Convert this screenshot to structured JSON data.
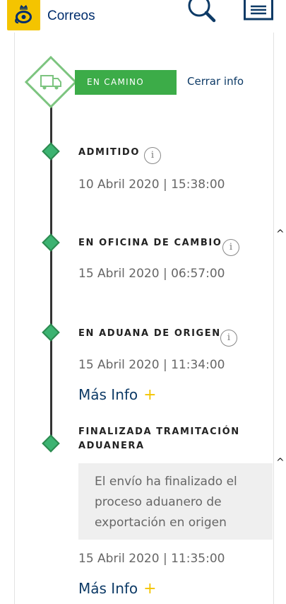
{
  "header": {
    "brand": "Correos",
    "icons": {
      "logo": "post-horn-crown-icon",
      "search": "search-icon",
      "menu": "menu-icon"
    },
    "colors": {
      "brand_yellow": "#f4c400",
      "brand_blue": "#002e6d"
    }
  },
  "status": {
    "label": "EN CAMINO",
    "close_label": "Cerrar info",
    "icon": "delivery-truck-icon",
    "color": "#3cac48"
  },
  "events": [
    {
      "title": "ADMITIDO",
      "date": "10 Abril 2020 | 15:38:00"
    },
    {
      "title": "EN OFICINA DE CAMBIO",
      "date": "15 Abril 2020 | 06:57:00"
    },
    {
      "title": "EN ADUANA DE ORIGEN",
      "date": "15 Abril 2020 | 11:34:00",
      "more_label": "Más Info",
      "more_icon": "+"
    },
    {
      "title_line1": "FINALIZADA TRAMITACIÓN",
      "title_line2": "ADUANERA",
      "note": "El envío ha finalizado el proceso aduanero de exportación en origen",
      "date": "15 Abril 2020 | 11:35:00",
      "more_label": "Más Info",
      "more_icon": "+"
    }
  ],
  "info_glyph": "i",
  "caret_glyph": "^"
}
